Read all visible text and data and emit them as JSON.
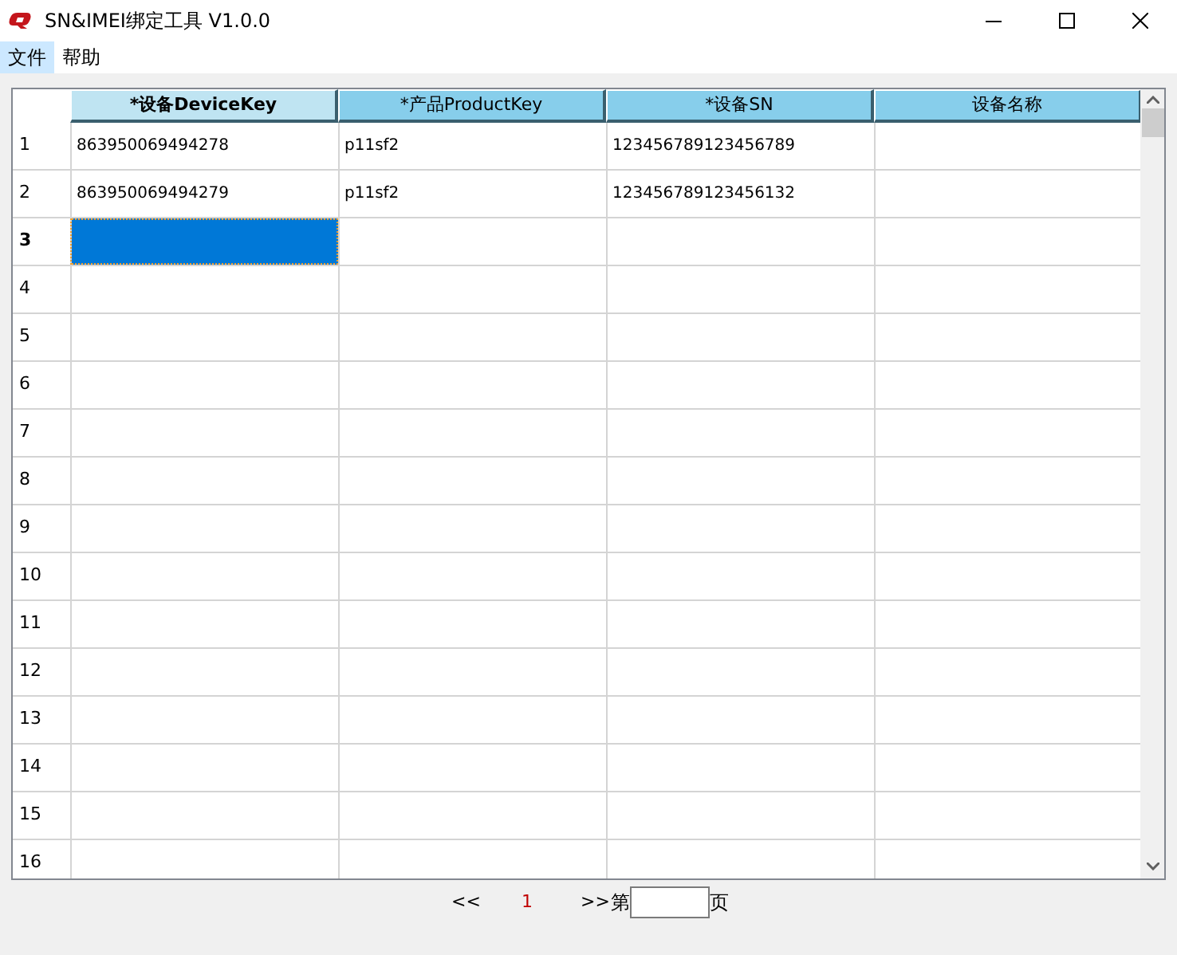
{
  "window": {
    "title": "SN&IMEI绑定工具 V1.0.0"
  },
  "menu": [
    {
      "label": "文件",
      "selected": true
    },
    {
      "label": "帮助",
      "selected": false
    }
  ],
  "table": {
    "columns": [
      {
        "label": "*设备DeviceKey",
        "selected": true
      },
      {
        "label": "*产品ProductKey",
        "selected": false
      },
      {
        "label": "*设备SN",
        "selected": false
      },
      {
        "label": "设备名称",
        "selected": false
      }
    ],
    "rows": [
      {
        "number": "1",
        "current": false,
        "cells": [
          {
            "text": "863950069494278",
            "selected": false
          },
          {
            "text": "p11sf2",
            "selected": false
          },
          {
            "text": "123456789123456789",
            "selected": false
          },
          {
            "selected": false
          }
        ]
      },
      {
        "number": "2",
        "current": false,
        "cells": [
          {
            "text": "863950069494279",
            "selected": false
          },
          {
            "text": "p11sf2",
            "selected": false
          },
          {
            "text": "123456789123456132",
            "selected": false
          },
          {
            "selected": false
          }
        ]
      },
      {
        "number": "3",
        "current": true,
        "cells": [
          {
            "selected": true
          },
          {
            "selected": false
          },
          {
            "selected": false
          },
          {
            "selected": false
          }
        ]
      },
      {
        "number": "4",
        "current": false,
        "cells": [
          {
            "selected": false
          },
          {
            "selected": false
          },
          {
            "selected": false
          },
          {
            "selected": false
          }
        ]
      },
      {
        "number": "5",
        "current": false,
        "cells": [
          {
            "selected": false
          },
          {
            "selected": false
          },
          {
            "selected": false
          },
          {
            "selected": false
          }
        ]
      },
      {
        "number": "6",
        "current": false,
        "cells": [
          {
            "selected": false
          },
          {
            "selected": false
          },
          {
            "selected": false
          },
          {
            "selected": false
          }
        ]
      },
      {
        "number": "7",
        "current": false,
        "cells": [
          {
            "selected": false
          },
          {
            "selected": false
          },
          {
            "selected": false
          },
          {
            "selected": false
          }
        ]
      },
      {
        "number": "8",
        "current": false,
        "cells": [
          {
            "selected": false
          },
          {
            "selected": false
          },
          {
            "selected": false
          },
          {
            "selected": false
          }
        ]
      },
      {
        "number": "9",
        "current": false,
        "cells": [
          {
            "selected": false
          },
          {
            "selected": false
          },
          {
            "selected": false
          },
          {
            "selected": false
          }
        ]
      },
      {
        "number": "10",
        "current": false,
        "cells": [
          {
            "selected": false
          },
          {
            "selected": false
          },
          {
            "selected": false
          },
          {
            "selected": false
          }
        ]
      },
      {
        "number": "11",
        "current": false,
        "cells": [
          {
            "selected": false
          },
          {
            "selected": false
          },
          {
            "selected": false
          },
          {
            "selected": false
          }
        ]
      },
      {
        "number": "12",
        "current": false,
        "cells": [
          {
            "selected": false
          },
          {
            "selected": false
          },
          {
            "selected": false
          },
          {
            "selected": false
          }
        ]
      },
      {
        "number": "13",
        "current": false,
        "cells": [
          {
            "selected": false
          },
          {
            "selected": false
          },
          {
            "selected": false
          },
          {
            "selected": false
          }
        ]
      },
      {
        "number": "14",
        "current": false,
        "cells": [
          {
            "selected": false
          },
          {
            "selected": false
          },
          {
            "selected": false
          },
          {
            "selected": false
          }
        ]
      },
      {
        "number": "15",
        "current": false,
        "cells": [
          {
            "selected": false
          },
          {
            "selected": false
          },
          {
            "selected": false
          },
          {
            "selected": false
          }
        ]
      },
      {
        "number": "16",
        "current": false,
        "cells": [
          {
            "selected": false
          },
          {
            "selected": false
          },
          {
            "selected": false
          },
          {
            "selected": false
          }
        ]
      }
    ]
  },
  "pager": {
    "prev": "<<",
    "page": "1",
    "next": ">>",
    "goto_prefix": "第",
    "goto_suffix": "页"
  }
}
